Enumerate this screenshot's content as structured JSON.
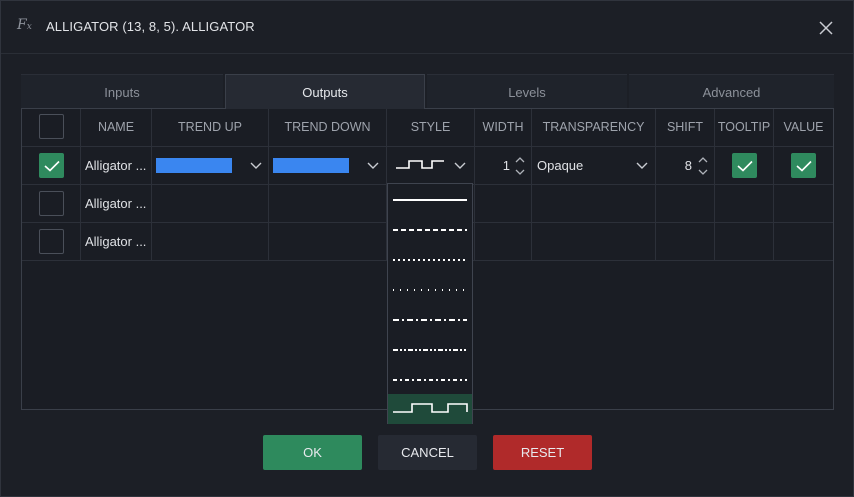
{
  "dialog": {
    "title": "ALLIGATOR (13, 8, 5). ALLIGATOR",
    "icon": "fx-icon",
    "close_icon": "close-icon"
  },
  "tabs": [
    {
      "label": "Inputs",
      "active": false
    },
    {
      "label": "Outputs",
      "active": true
    },
    {
      "label": "Levels",
      "active": false
    },
    {
      "label": "Advanced",
      "active": false
    }
  ],
  "table": {
    "headers": {
      "select": "",
      "name": "NAME",
      "trend_up": "TREND UP",
      "trend_down": "TREND DOWN",
      "style": "STYLE",
      "width": "WIDTH",
      "transparency": "TRANSPARENCY",
      "shift": "SHIFT",
      "tooltip": "TOOLTIP",
      "value": "VALUE"
    },
    "rows": [
      {
        "checked": true,
        "name": "Alligator ...",
        "trend_up_color": "#3a86f0",
        "trend_down_color": "#3a86f0",
        "style": "step-line",
        "width": "1",
        "transparency": "Opaque",
        "shift": "8",
        "tooltip": true,
        "value": true
      },
      {
        "checked": false,
        "name": "Alligator ..."
      },
      {
        "checked": false,
        "name": "Alligator ..."
      }
    ]
  },
  "style_dropdown": {
    "options": [
      "solid",
      "dashed",
      "dotted",
      "sparse-dotted",
      "dash-dot",
      "dash-dot-dot",
      "long-dash-dot",
      "step-line"
    ],
    "selected": "step-line"
  },
  "buttons": {
    "ok": "OK",
    "cancel": "CANCEL",
    "reset": "RESET"
  },
  "colors": {
    "accent_green": "#2e8a5d",
    "reset_red": "#b02a2a",
    "swatch_blue": "#3a86f0"
  }
}
